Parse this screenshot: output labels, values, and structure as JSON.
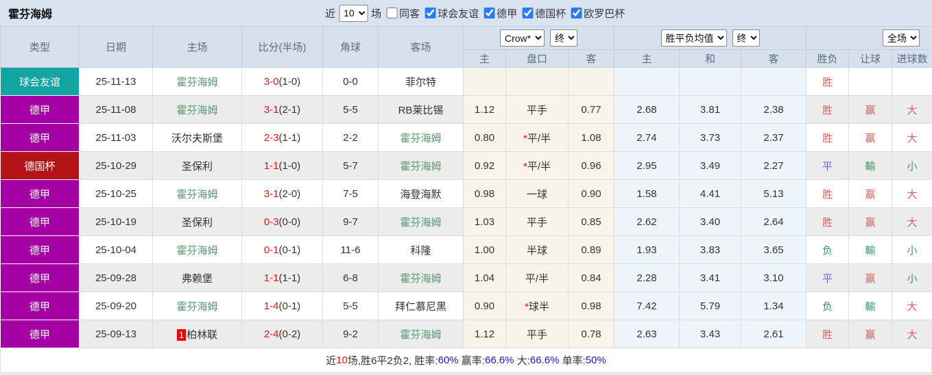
{
  "header": {
    "team_title": "霍芬海姆",
    "recent_label": "近",
    "recent_value": "10",
    "games_label": "场",
    "same_venue": {
      "label": "同客",
      "checked": false
    },
    "competitions": [
      {
        "label": "球会友谊",
        "checked": true
      },
      {
        "label": "德甲",
        "checked": true
      },
      {
        "label": "德国杯",
        "checked": true
      },
      {
        "label": "欧罗巴杯",
        "checked": true
      }
    ]
  },
  "table": {
    "columns": {
      "type": "类型",
      "date": "日期",
      "home": "主场",
      "score": "比分(半场)",
      "corner": "角球",
      "away": "客场"
    },
    "dropdowns": {
      "company": "Crow*",
      "company_state": "终",
      "avg": "胜平负均值",
      "avg_state": "终",
      "scope": "全场"
    },
    "subheaders": {
      "odds_home": "主",
      "odds_handicap": "盘口",
      "odds_away": "客",
      "avg_home": "主",
      "avg_draw": "和",
      "avg_away": "客",
      "result": "胜负",
      "handicap_result": "让球",
      "goals": "进球数"
    },
    "type_colors": {
      "球会友谊": "#12a3a3",
      "德甲": "#a400a4",
      "德国杯": "#b31217"
    },
    "status_colors": {
      "red": "#d95f5f",
      "blue": "#6a6ad8",
      "green": "#3b9b63"
    },
    "rows": [
      {
        "type": "球会友谊",
        "date": "25-11-13",
        "home": "霍芬海姆",
        "home_is_team": true,
        "home_badge": "",
        "score": "3-0",
        "half": "(1-0)",
        "corner": "0-0",
        "away": "菲尔特",
        "away_is_team": false,
        "odds_home": "",
        "handicap": "",
        "odds_away": "",
        "avg_home": "",
        "avg_draw": "",
        "avg_away": "",
        "result": "胜",
        "result_color": "red",
        "handicap_result": "",
        "handicap_result_color": "",
        "goals": "",
        "goals_color": ""
      },
      {
        "type": "德甲",
        "date": "25-11-08",
        "home": "霍芬海姆",
        "home_is_team": true,
        "home_badge": "",
        "score": "3-1",
        "half": "(2-1)",
        "corner": "5-5",
        "away": "RB莱比锡",
        "away_is_team": false,
        "odds_home": "1.12",
        "handicap": "平手",
        "odds_away": "0.77",
        "avg_home": "2.68",
        "avg_draw": "3.81",
        "avg_away": "2.38",
        "result": "胜",
        "result_color": "red",
        "handicap_result": "赢",
        "handicap_result_color": "red",
        "goals": "大",
        "goals_color": "red"
      },
      {
        "type": "德甲",
        "date": "25-11-03",
        "home": "沃尔夫斯堡",
        "home_is_team": false,
        "home_badge": "",
        "score": "2-3",
        "half": "(1-1)",
        "corner": "2-2",
        "away": "霍芬海姆",
        "away_is_team": true,
        "odds_home": "0.80",
        "handicap": "*平/半",
        "odds_away": "1.08",
        "avg_home": "2.74",
        "avg_draw": "3.73",
        "avg_away": "2.37",
        "result": "胜",
        "result_color": "red",
        "handicap_result": "赢",
        "handicap_result_color": "red",
        "goals": "大",
        "goals_color": "red"
      },
      {
        "type": "德国杯",
        "date": "25-10-29",
        "home": "圣保利",
        "home_is_team": false,
        "home_badge": "",
        "score": "1-1",
        "half": "(1-0)",
        "corner": "5-7",
        "away": "霍芬海姆",
        "away_is_team": true,
        "odds_home": "0.92",
        "handicap": "*平/半",
        "odds_away": "0.96",
        "avg_home": "2.95",
        "avg_draw": "3.49",
        "avg_away": "2.27",
        "result": "平",
        "result_color": "blue",
        "handicap_result": "輸",
        "handicap_result_color": "green",
        "goals": "小",
        "goals_color": "green"
      },
      {
        "type": "德甲",
        "date": "25-10-25",
        "home": "霍芬海姆",
        "home_is_team": true,
        "home_badge": "",
        "score": "3-1",
        "half": "(2-0)",
        "corner": "7-5",
        "away": "海登海默",
        "away_is_team": false,
        "odds_home": "0.98",
        "handicap": "一球",
        "odds_away": "0.90",
        "avg_home": "1.58",
        "avg_draw": "4.41",
        "avg_away": "5.13",
        "result": "胜",
        "result_color": "red",
        "handicap_result": "赢",
        "handicap_result_color": "red",
        "goals": "大",
        "goals_color": "red"
      },
      {
        "type": "德甲",
        "date": "25-10-19",
        "home": "圣保利",
        "home_is_team": false,
        "home_badge": "",
        "score": "0-3",
        "half": "(0-0)",
        "corner": "9-7",
        "away": "霍芬海姆",
        "away_is_team": true,
        "odds_home": "1.03",
        "handicap": "平手",
        "odds_away": "0.85",
        "avg_home": "2.62",
        "avg_draw": "3.40",
        "avg_away": "2.64",
        "result": "胜",
        "result_color": "red",
        "handicap_result": "赢",
        "handicap_result_color": "red",
        "goals": "大",
        "goals_color": "red"
      },
      {
        "type": "德甲",
        "date": "25-10-04",
        "home": "霍芬海姆",
        "home_is_team": true,
        "home_badge": "",
        "score": "0-1",
        "half": "(0-1)",
        "corner": "11-6",
        "away": "科隆",
        "away_is_team": false,
        "odds_home": "1.00",
        "handicap": "半球",
        "odds_away": "0.89",
        "avg_home": "1.93",
        "avg_draw": "3.83",
        "avg_away": "3.65",
        "result": "负",
        "result_color": "green",
        "handicap_result": "輸",
        "handicap_result_color": "green",
        "goals": "小",
        "goals_color": "green"
      },
      {
        "type": "德甲",
        "date": "25-09-28",
        "home": "弗赖堡",
        "home_is_team": false,
        "home_badge": "",
        "score": "1-1",
        "half": "(1-1)",
        "corner": "6-8",
        "away": "霍芬海姆",
        "away_is_team": true,
        "odds_home": "1.04",
        "handicap": "平/半",
        "odds_away": "0.84",
        "avg_home": "2.28",
        "avg_draw": "3.41",
        "avg_away": "3.10",
        "result": "平",
        "result_color": "blue",
        "handicap_result": "赢",
        "handicap_result_color": "red",
        "goals": "小",
        "goals_color": "green"
      },
      {
        "type": "德甲",
        "date": "25-09-20",
        "home": "霍芬海姆",
        "home_is_team": true,
        "home_badge": "",
        "score": "1-4",
        "half": "(0-1)",
        "corner": "5-5",
        "away": "拜仁慕尼黑",
        "away_is_team": false,
        "odds_home": "0.90",
        "handicap": "*球半",
        "odds_away": "0.98",
        "avg_home": "7.42",
        "avg_draw": "5.79",
        "avg_away": "1.34",
        "result": "负",
        "result_color": "green",
        "handicap_result": "輸",
        "handicap_result_color": "green",
        "goals": "大",
        "goals_color": "red"
      },
      {
        "type": "德甲",
        "date": "25-09-13",
        "home": "柏林联",
        "home_is_team": false,
        "home_badge": "1",
        "score": "2-4",
        "half": "(0-2)",
        "corner": "9-2",
        "away": "霍芬海姆",
        "away_is_team": true,
        "odds_home": "1.12",
        "handicap": "平手",
        "odds_away": "0.78",
        "avg_home": "2.63",
        "avg_draw": "3.43",
        "avg_away": "2.61",
        "result": "胜",
        "result_color": "red",
        "handicap_result": "赢",
        "handicap_result_color": "red",
        "goals": "大",
        "goals_color": "red"
      }
    ]
  },
  "footer": {
    "segments": [
      {
        "text": "近",
        "color": "dark"
      },
      {
        "text": "10",
        "color": "red"
      },
      {
        "text": "场,胜6平2负2, 胜率:",
        "color": "dark"
      },
      {
        "text": "60%",
        "color": "blue"
      },
      {
        "text": " 赢率:",
        "color": "dark"
      },
      {
        "text": "66.6%",
        "color": "blue"
      },
      {
        "text": " 大:",
        "color": "dark"
      },
      {
        "text": "66.6%",
        "color": "blue"
      },
      {
        "text": " 单率:",
        "color": "dark"
      },
      {
        "text": "50%",
        "color": "blue"
      }
    ]
  }
}
